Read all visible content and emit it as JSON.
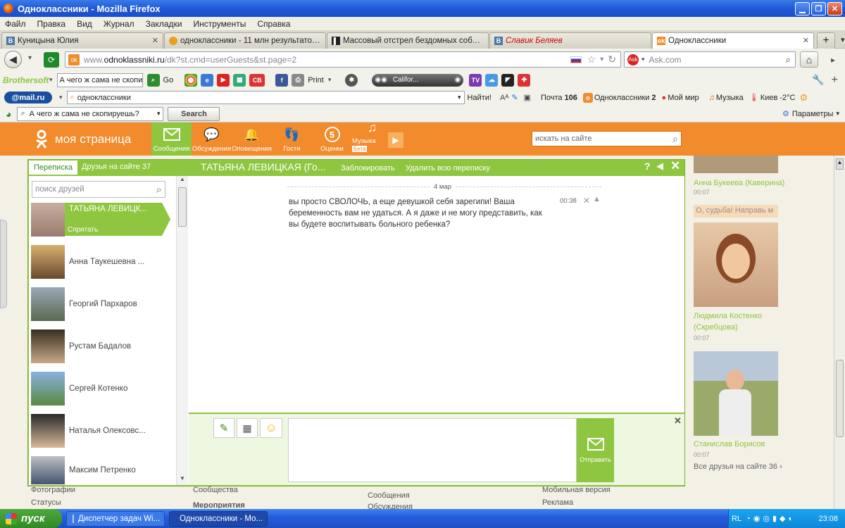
{
  "window": {
    "title": "Одноклассники - Mozilla Firefox"
  },
  "menu": [
    "Файл",
    "Правка",
    "Вид",
    "Журнал",
    "Закладки",
    "Инструменты",
    "Справка"
  ],
  "tabs": [
    {
      "label": "Куницына Юлия",
      "icon": "vk-icon"
    },
    {
      "label": "одноклассники - 11 млн результатов...",
      "icon": "search-icon"
    },
    {
      "label": "Массовый отстрел бездомных собак в...",
      "icon": "news-icon"
    },
    {
      "label": "Славик Беляев",
      "icon": "vk-icon"
    },
    {
      "label": "Одноклассники",
      "icon": "ok-icon",
      "active": true
    }
  ],
  "address": {
    "url_gray": "www.",
    "url_domain": "odnoklassniki.ru",
    "url_path": "/dk?st.cmd=userGuests&st.page=2"
  },
  "ask_search": {
    "placeholder": "Ask.com"
  },
  "brothersoft": {
    "logo": "Brothersoft",
    "query": "А чего ж сама не скопируй",
    "go": "Go",
    "print": "Print",
    "player": "Califor..."
  },
  "mailru": {
    "logo": "@mail.ru",
    "query": "одноклассники",
    "find": "Найти!",
    "mail": "Почта",
    "mail_count": "106",
    "ok": "Одноклассники",
    "ok_count": "2",
    "world": "Мой мир",
    "music": "Музыка",
    "weather": "Киев -2°C"
  },
  "searchbar": {
    "query": "А чего ж сама не скопируешь?",
    "button": "Search",
    "params": "Параметры"
  },
  "ok": {
    "logo": "моя страница",
    "nav": [
      {
        "label": "Сообщения",
        "icon": "envelope-icon",
        "active": true
      },
      {
        "label": "Обсуждения",
        "icon": "chat-bubbles-icon"
      },
      {
        "label": "Оповещения",
        "icon": "bell-icon"
      },
      {
        "label": "Гости",
        "icon": "footprints-icon"
      },
      {
        "label": "Оценки",
        "icon": "rating-icon",
        "badge": "5"
      },
      {
        "label": "Музыка",
        "icon": "music-note-icon",
        "beta": "Бета"
      }
    ],
    "site_search": "искать на сайте"
  },
  "chat": {
    "tab_correspondence": "Переписка",
    "tab_online": "Друзья на сайте 37",
    "friend_search": "поиск друзей",
    "header_name": "ТАТЬЯНА ЛЕВИЦКАЯ (Го...",
    "block": "Заблокировать",
    "delete_all": "Удалить всю переписку",
    "help": "?",
    "date": "4 мар",
    "message": "вы просто СВОЛОЧЬ, а еще девушкой себя зарегипи! Ваша беременность вам не удаться. А я даже и не могу представить, как вы будете воспитывать больного ребенка?",
    "time": "00:38",
    "send": "Отправить",
    "friends": [
      {
        "name": "ТАТЬЯНА ЛЕВИЦК...",
        "hide": "Спрятать",
        "active": true
      },
      {
        "name": "Анна Таукешевна ..."
      },
      {
        "name": "Георгий Пархаров"
      },
      {
        "name": "Рустам Бадалов"
      },
      {
        "name": "Сергей Котенко"
      },
      {
        "name": "Наталья Олексовс..."
      },
      {
        "name": "Максим Петренко"
      }
    ]
  },
  "sidebar": {
    "p1_name": "Анна Букеева (Каверина)",
    "p1_time": "00:07",
    "status": "О, судьба! Направь м",
    "p2_name": "Людмила Костенко",
    "p2_name2": "(Скребцова)",
    "p2_time": "00:07",
    "p3_name": "Станислав Борисов",
    "p3_time": "00:07",
    "all_online": "Все друзья на сайте 36 ›"
  },
  "footer": {
    "c1": [
      "Фотографии",
      "Статусы"
    ],
    "c2": [
      "Сообщества",
      "Мероприятия"
    ],
    "c3": [
      "Сообщения",
      "Обсуждения"
    ],
    "c4": [
      "Мобильная версия",
      "Реклама"
    ]
  },
  "taskbar": {
    "start": "пуск",
    "task1": "Диспетчер задач Wi...",
    "task2": "Одноклассники - Mo...",
    "lang": "RL",
    "clock": "23:08"
  }
}
